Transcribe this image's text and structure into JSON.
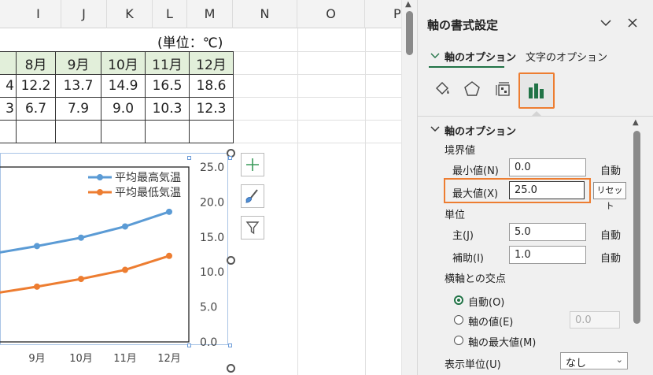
{
  "sheet": {
    "columns": [
      "I",
      "J",
      "K",
      "L",
      "M",
      "N",
      "O",
      "P"
    ],
    "unit_label": "(単位：℃)",
    "table": {
      "header": [
        "",
        "8月",
        "9月",
        "10月",
        "11月",
        "12月"
      ],
      "rows": [
        [
          "4",
          "12.2",
          "13.7",
          "14.9",
          "16.5",
          "18.6"
        ],
        [
          "3",
          "6.7",
          "7.9",
          "9.0",
          "10.3",
          "12.3"
        ],
        [
          "",
          "",
          "",
          "",
          "",
          ""
        ]
      ]
    }
  },
  "chart_data": {
    "type": "line",
    "categories": [
      "9月",
      "10月",
      "11月",
      "12月"
    ],
    "series": [
      {
        "name": "平均最高気温",
        "color": "#5b9bd5",
        "values": [
          13.7,
          14.9,
          16.5,
          18.6
        ]
      },
      {
        "name": "平均最低気温",
        "color": "#ed7d31",
        "values": [
          7.9,
          9.0,
          10.3,
          12.3
        ]
      }
    ],
    "y_ticks": [
      "25.0",
      "20.0",
      "15.0",
      "10.0",
      "5.0",
      "0.0"
    ],
    "ylim": [
      0,
      25
    ],
    "x_tick_labels": [
      "9月",
      "10月",
      "11月",
      "12月"
    ],
    "y_axis_position": "right",
    "legend_position": "top-right",
    "grid": false
  },
  "chart_buttons": [
    {
      "icon": "plus-icon"
    },
    {
      "icon": "brush-icon"
    },
    {
      "icon": "filter-icon"
    }
  ],
  "pane": {
    "title": "軸の書式設定",
    "tabs": {
      "axis_options": "軸のオプション",
      "text_options": "文字のオプション"
    },
    "section": "軸のオプション",
    "bounds": {
      "heading": "境界値",
      "min_label": "最小値(N)",
      "min_value": "0.0",
      "min_state": "自動",
      "max_label": "最大値(X)",
      "max_value": "25.0",
      "reset": "リセット"
    },
    "units": {
      "heading": "単位",
      "major_label": "主(J)",
      "major_value": "5.0",
      "major_state": "自動",
      "minor_label": "補助(I)",
      "minor_value": "1.0",
      "minor_state": "自動"
    },
    "crosses": {
      "heading": "横軸との交点",
      "opt_auto": "自動(O)",
      "opt_value": "軸の値(E)",
      "opt_value_field": "0.0",
      "opt_max": "軸の最大値(M)"
    },
    "display_units": {
      "label": "表示単位(U)",
      "value": "なし"
    },
    "colors": {
      "accent": "#217346",
      "highlight": "#ed7d31"
    }
  }
}
